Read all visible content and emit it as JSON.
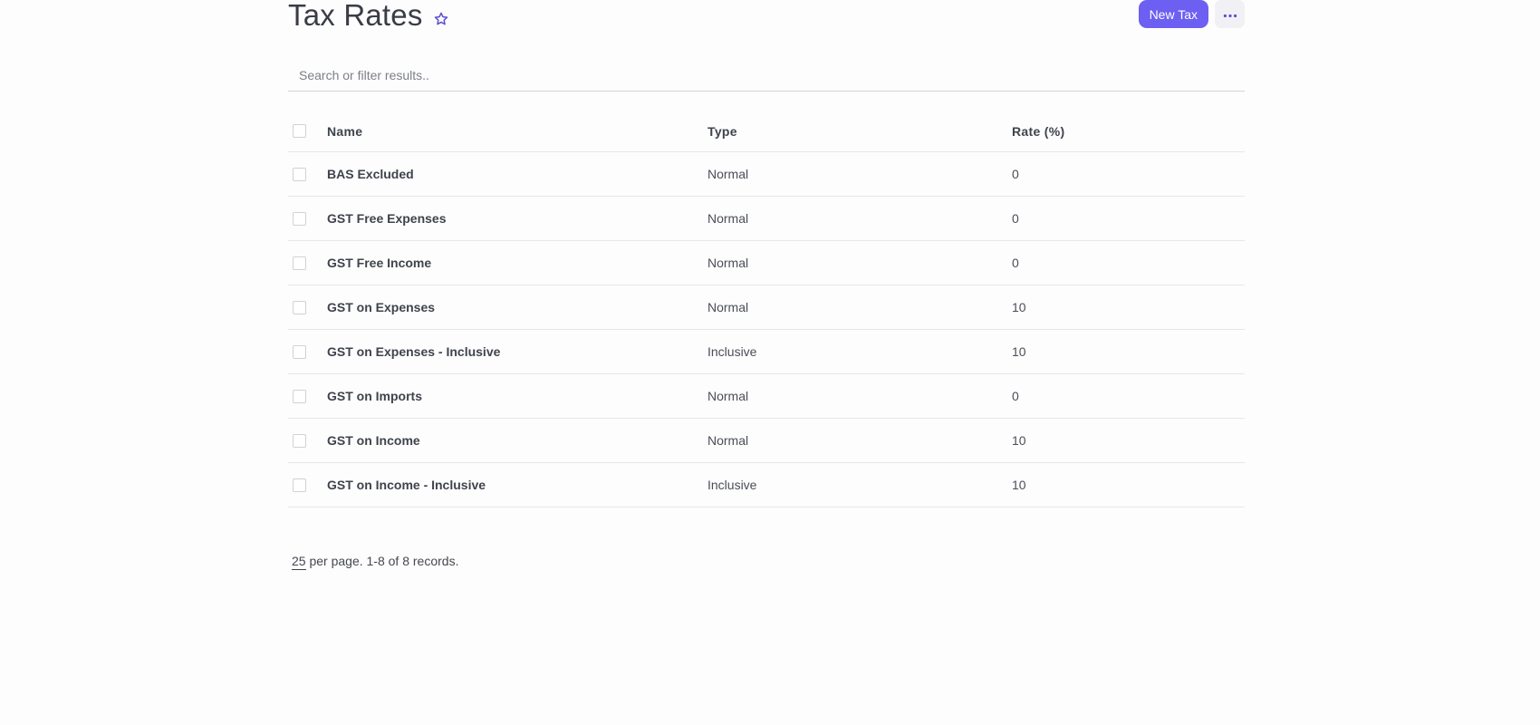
{
  "header": {
    "title": "Tax Rates",
    "new_button_label": "New Tax"
  },
  "search": {
    "placeholder": "Search or filter results.."
  },
  "table": {
    "columns": [
      "Name",
      "Type",
      "Rate (%)"
    ],
    "rows": [
      {
        "name": "BAS Excluded",
        "type": "Normal",
        "rate": "0"
      },
      {
        "name": "GST Free Expenses",
        "type": "Normal",
        "rate": "0"
      },
      {
        "name": "GST Free Income",
        "type": "Normal",
        "rate": "0"
      },
      {
        "name": "GST on Expenses",
        "type": "Normal",
        "rate": "10"
      },
      {
        "name": "GST on Expenses - Inclusive",
        "type": "Inclusive",
        "rate": "10"
      },
      {
        "name": "GST on Imports",
        "type": "Normal",
        "rate": "0"
      },
      {
        "name": "GST on Income",
        "type": "Normal",
        "rate": "10"
      },
      {
        "name": "GST on Income - Inclusive",
        "type": "Inclusive",
        "rate": "10"
      }
    ]
  },
  "pagination": {
    "per_page": "25",
    "summary": "per page. 1-8 of 8 records."
  },
  "icons": {
    "favorite": "star-outline-icon",
    "more": "ellipsis-horizontal-icon"
  },
  "colors": {
    "accent": "#6c5ff1",
    "star": "#5a4fcf"
  }
}
